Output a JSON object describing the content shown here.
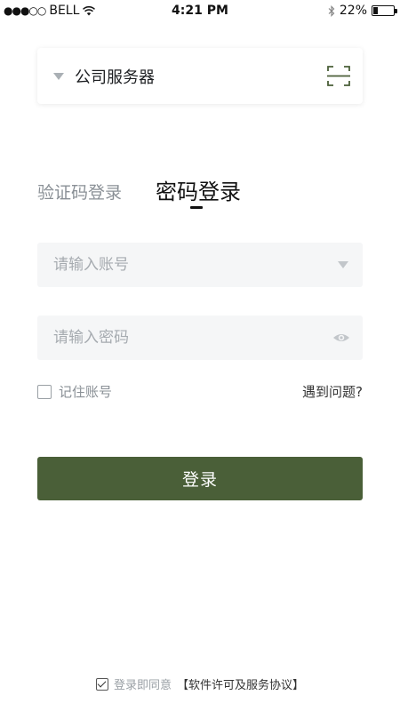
{
  "status_bar": {
    "carrier": "BELL",
    "signal": "●●●○○",
    "time": "4:21 PM",
    "battery": "22%",
    "battery_level": 0.22
  },
  "server": {
    "name": "公司服务器"
  },
  "tabs": {
    "sms_login": "验证码登录",
    "password_login": "密码登录",
    "active": "password_login"
  },
  "account": {
    "placeholder": "请输入账号",
    "value": ""
  },
  "password": {
    "placeholder": "请输入密码",
    "value": ""
  },
  "remember": {
    "label": "记住账号",
    "checked": false
  },
  "help_link": "遇到问题?",
  "login_button": "登录",
  "agreement": {
    "text": "登录即同意",
    "link": "【软件许可及服务协议】",
    "checked": true
  },
  "colors": {
    "primary": "#4a5f38",
    "input_bg": "#f5f6f7",
    "muted_text": "#8a9096"
  }
}
